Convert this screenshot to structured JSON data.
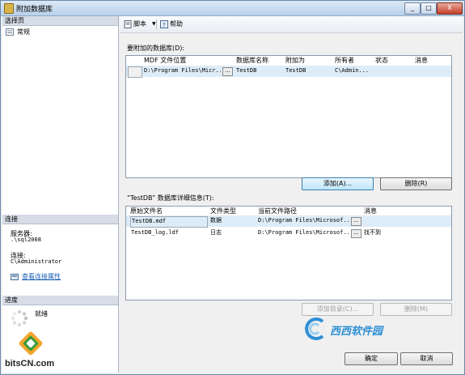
{
  "window": {
    "title": "附加数据库",
    "min": "_",
    "max": "□",
    "close": "X"
  },
  "left": {
    "select_page_header": "选择页",
    "pages": [
      {
        "label": "常规"
      }
    ],
    "connection_header": "连接",
    "server_label": "服务器:",
    "server_value": ".\\sql2008",
    "conn_label": "连接:",
    "conn_value": "C\\Administrator",
    "view_conn_props": "查看连接属性",
    "progress_header": "进度",
    "progress_status": "就绪"
  },
  "toolbar": {
    "script_label": "脚本",
    "help_label": "帮助"
  },
  "attach_section": {
    "label": "要附加的数据库(D):",
    "columns": [
      "MDF 文件位置",
      "数据库名称",
      "附加为",
      "所有者",
      "状态",
      "消息"
    ],
    "rows": [
      {
        "mdf": "D:\\Program Files\\Micr...",
        "db_name": "TestDB",
        "attach_as": "TestDB",
        "owner": "C\\Admin...",
        "status": "",
        "message": ""
      }
    ],
    "add_button": "添加(A)...",
    "remove_button": "删除(R)"
  },
  "details_section": {
    "label": "“TestDB” 数据库详细信息(T):",
    "columns": [
      "原始文件名",
      "文件类型",
      "当前文件路径",
      "消息"
    ],
    "rows": [
      {
        "filename": "TestDB.mdf",
        "type": "数据",
        "path": "D:\\Program Files\\Microsof...",
        "message": ""
      },
      {
        "filename": "TestDB_log.ldf",
        "type": "日志",
        "path": "D:\\Program Files\\Microsof...",
        "message": "找不到"
      }
    ],
    "add_catalog_button": "添加目录(C)...",
    "remove_button": "删除(M)"
  },
  "footer": {
    "ok_button": "确定",
    "cancel_button": "取消"
  },
  "watermark": {
    "left": "bitsCN.com",
    "right": "西西软件园"
  }
}
